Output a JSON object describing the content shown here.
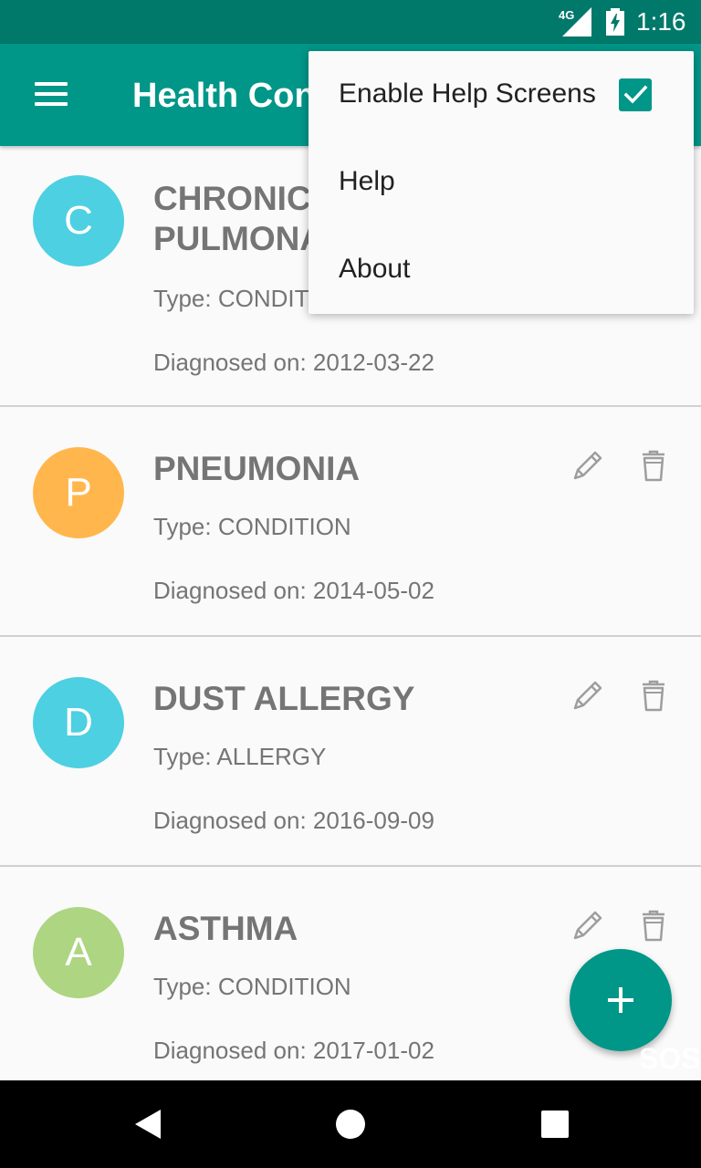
{
  "status_bar": {
    "network": "4G",
    "time": "1:16"
  },
  "app_bar": {
    "title": "Health Conditions"
  },
  "conditions": [
    {
      "initial": "C",
      "avatar_color": "#4dd0e1",
      "name_line1": "CHRONIC OBSTRUCTIVE",
      "name_line2": "PULMONARY DISEASE",
      "type": "Type: CONDITION",
      "diagnosed": "Diagnosed on: 2012-03-22"
    },
    {
      "initial": "P",
      "avatar_color": "#ffb74d",
      "name": "PNEUMONIA",
      "type": "Type: CONDITION",
      "diagnosed": "Diagnosed on: 2014-05-02"
    },
    {
      "initial": "D",
      "avatar_color": "#4dd0e1",
      "name": "DUST ALLERGY",
      "type": "Type: ALLERGY",
      "diagnosed": "Diagnosed on: 2016-09-09"
    },
    {
      "initial": "A",
      "avatar_color": "#aed581",
      "name": "ASTHMA",
      "type": "Type: CONDITION",
      "diagnosed": "Diagnosed on: 2017-01-02"
    }
  ],
  "fab": {
    "icon": "plus-icon",
    "overlay_text": "SOS"
  },
  "popup_menu": {
    "items": [
      {
        "label": "Enable Help Screens",
        "checked": true
      },
      {
        "label": "Help"
      },
      {
        "label": "About"
      }
    ]
  },
  "colors": {
    "primary": "#009688",
    "primary_dark": "#00796b",
    "text_secondary": "#757575"
  }
}
